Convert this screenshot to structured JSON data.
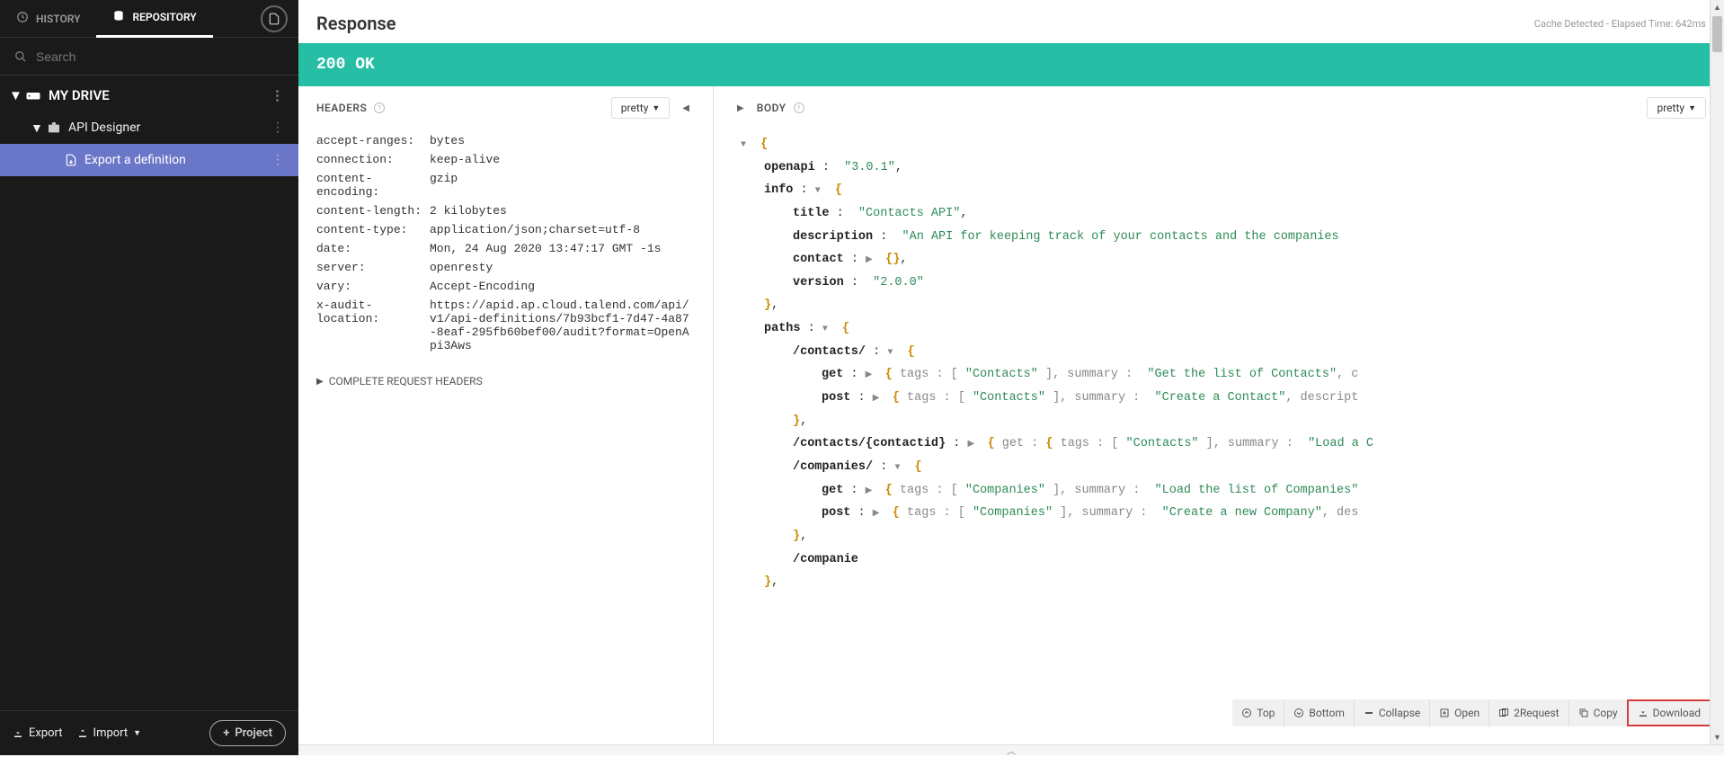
{
  "sidebar": {
    "tabs": {
      "history": "HISTORY",
      "repository": "REPOSITORY"
    },
    "search_placeholder": "Search",
    "tree": {
      "root": "MY DRIVE",
      "level1": "API Designer",
      "level2": "Export a definition"
    },
    "footer": {
      "export": "Export",
      "import": "Import",
      "project": "Project"
    }
  },
  "response": {
    "title": "Response",
    "cache_info": "Cache Detected - Elapsed Time: 642ms",
    "status_code": "200",
    "status_text": "OK"
  },
  "panels": {
    "headers_title": "HEADERS",
    "body_title": "BODY",
    "pretty_label": "pretty"
  },
  "headers": [
    {
      "k": "accept-ranges:",
      "v": "bytes"
    },
    {
      "k": "connection:",
      "v": "keep-alive"
    },
    {
      "k": "content-encoding:",
      "v": "gzip"
    },
    {
      "k": "content-length:",
      "v": "2 kilobytes"
    },
    {
      "k": "content-type:",
      "v": "application/json;charset=utf-8"
    },
    {
      "k": "date:",
      "v": "Mon, 24 Aug 2020 13:47:17 GMT -1s"
    },
    {
      "k": "server:",
      "v": "openresty"
    },
    {
      "k": "vary:",
      "v": "Accept-Encoding"
    },
    {
      "k": "x-audit-location:",
      "v": "https://apid.ap.cloud.talend.com/api/v1/api-definitions/7b93bcf1-7d47-4a87-8eaf-295fb60bef00/audit?format=OpenApi3Aws"
    }
  ],
  "complete_headers_label": "COMPLETE REQUEST HEADERS",
  "body_json": {
    "openapi_key": "openapi",
    "openapi_val": "\"3.0.1\"",
    "info_key": "info",
    "title_key": "title",
    "title_val": "\"Contacts API\"",
    "description_key": "description",
    "description_val": "\"An API for keeping track of your contacts and the companies",
    "contact_key": "contact",
    "version_key": "version",
    "version_val": "\"2.0.0\"",
    "paths_key": "paths",
    "path_contacts": "/contacts/",
    "path_contacts_id": "/contacts/{contactid}",
    "path_companies": "/companies/",
    "path_companies_trunc": "/companie",
    "get_key": "get",
    "post_key": "post",
    "tags_key": "tags",
    "summary_key": "summary",
    "tag_contacts": "\"Contacts\"",
    "tag_companies": "\"Companies\"",
    "sum_get_contacts": "\"Get the list of Contacts\"",
    "sum_post_contacts": "\"Create a Contact\"",
    "sum_load_contact": "\"Load a C",
    "sum_load_companies": "\"Load the list of Companies\"",
    "sum_create_company": "\"Create a new Company\"",
    "descript_trunc": "descript",
    "des_trunc": "des",
    "c_trunc": "c"
  },
  "toolbar": {
    "top": "Top",
    "bottom": "Bottom",
    "collapse": "Collapse",
    "open": "Open",
    "request": "2Request",
    "copy": "Copy",
    "download": "Download"
  }
}
